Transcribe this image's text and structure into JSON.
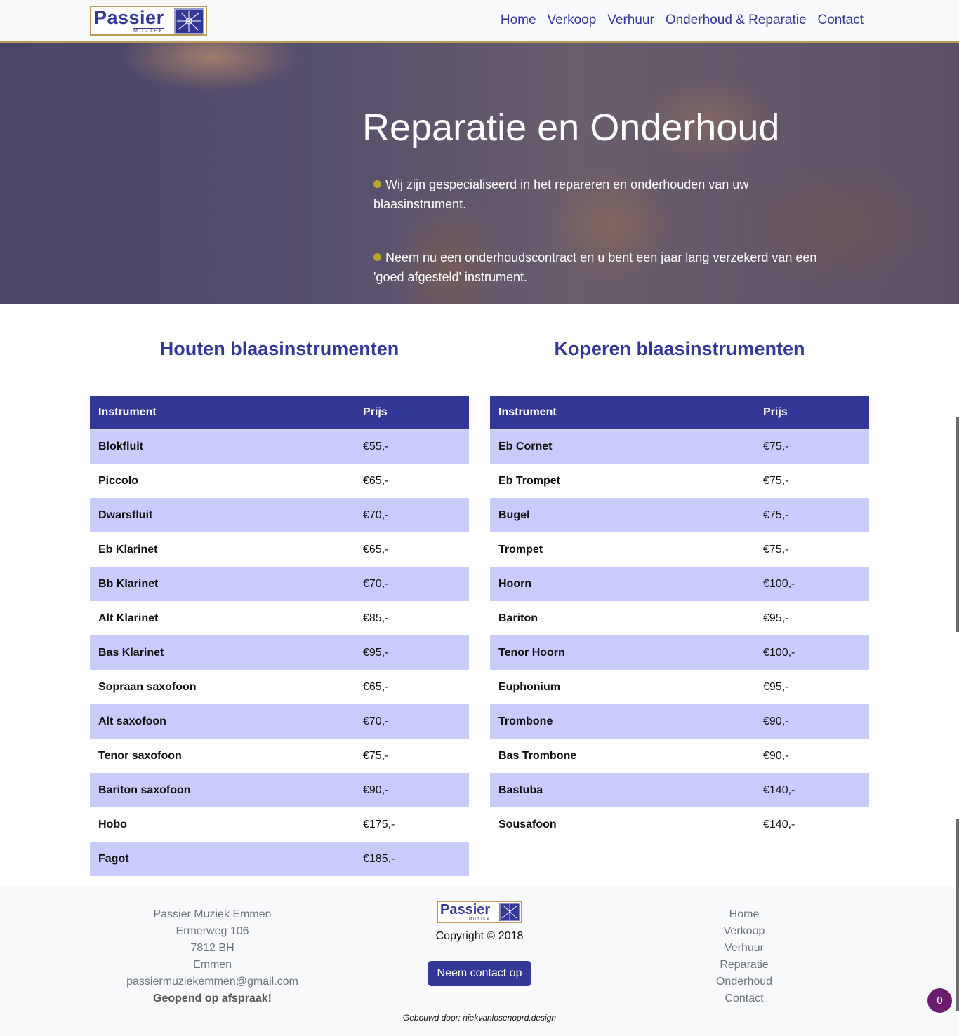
{
  "brand": {
    "name": "Passier",
    "sub": "MUZIEK",
    "primary_color": "#333796",
    "gold_color": "#b79a55",
    "logo_icon": "logo-mark-icon"
  },
  "nav": {
    "items": [
      "Home",
      "Verkoop",
      "Verhuur",
      "Onderhoud & Reparatie",
      "Contact"
    ]
  },
  "hero": {
    "title": "Reparatie en Onderhoud",
    "bullets": [
      "Wij zijn gespecialiseerd in het repareren en onderhouden van uw blaasinstrument.",
      "Neem nu een onderhoudscontract en u bent een jaar lang verzekerd van een 'goed afgesteld' instrument."
    ],
    "bullet_color": "#b9a334"
  },
  "tables": {
    "left": {
      "heading": "Houten blaasinstrumenten",
      "col_instrument": "Instrument",
      "col_price": "Prijs",
      "rows": [
        {
          "instrument": "Blokfluit",
          "price": "€55,-"
        },
        {
          "instrument": "Piccolo",
          "price": "€65,-"
        },
        {
          "instrument": "Dwarsfluit",
          "price": "€70,-"
        },
        {
          "instrument": "Eb Klarinet",
          "price": "€65,-"
        },
        {
          "instrument": "Bb Klarinet",
          "price": "€70,-"
        },
        {
          "instrument": "Alt Klarinet",
          "price": "€85,-"
        },
        {
          "instrument": "Bas Klarinet",
          "price": "€95,-"
        },
        {
          "instrument": "Sopraan saxofoon",
          "price": "€65,-"
        },
        {
          "instrument": "Alt saxofoon",
          "price": "€70,-"
        },
        {
          "instrument": "Tenor saxofoon",
          "price": "€75,-"
        },
        {
          "instrument": "Bariton saxofoon",
          "price": "€90,-"
        },
        {
          "instrument": "Hobo",
          "price": "€175,-"
        },
        {
          "instrument": "Fagot",
          "price": "€185,-"
        }
      ]
    },
    "right": {
      "heading": "Koperen blaasinstrumenten",
      "col_instrument": "Instrument",
      "col_price": "Prijs",
      "rows": [
        {
          "instrument": "Eb Cornet",
          "price": "€75,-"
        },
        {
          "instrument": "Eb Trompet",
          "price": "€75,-"
        },
        {
          "instrument": "Bugel",
          "price": "€75,-"
        },
        {
          "instrument": "Trompet",
          "price": "€75,-"
        },
        {
          "instrument": "Hoorn",
          "price": "€100,-"
        },
        {
          "instrument": "Bariton",
          "price": "€95,-"
        },
        {
          "instrument": "Tenor Hoorn",
          "price": "€100,-"
        },
        {
          "instrument": "Euphonium",
          "price": "€95,-"
        },
        {
          "instrument": "Trombone",
          "price": "€90,-"
        },
        {
          "instrument": "Bas Trombone",
          "price": "€90,-"
        },
        {
          "instrument": "Bastuba",
          "price": "€140,-"
        },
        {
          "instrument": "Sousafoon",
          "price": "€140,-"
        }
      ]
    },
    "stripe_color": "#cacbfd"
  },
  "footer": {
    "address": [
      "Passier Muziek Emmen",
      "Ermerweg 106",
      "7812 BH",
      "Emmen",
      "passiermuziekemmen@gmail.com"
    ],
    "hours": "Geopend op afspraak!",
    "copyright": "Copyright © 2018",
    "contact_button": "Neem contact op",
    "links": [
      "Home",
      "Verkoop",
      "Verhuur",
      "Reparatie",
      "Onderhoud",
      "Contact"
    ],
    "built_by": "Gebouwd door: niekvanlosenoord.design"
  },
  "cart": {
    "count": "0",
    "color": "#6b1c6e"
  }
}
